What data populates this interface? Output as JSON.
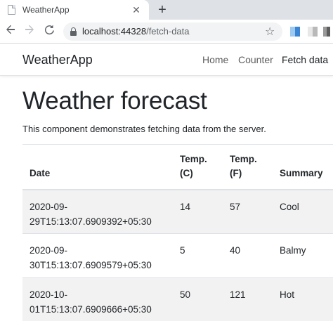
{
  "browser": {
    "tab_title": "WeatherApp",
    "tab_close_glyph": "✕",
    "new_tab_glyph": "+",
    "url_host": "localhost:44328",
    "url_path": "/fetch-data",
    "icons": [
      "favicon-icon",
      "back-arrow-icon",
      "forward-arrow-icon",
      "reload-icon",
      "lock-icon",
      "star-icon",
      "extension-icon"
    ]
  },
  "app": {
    "brand": "WeatherApp",
    "nav": [
      {
        "label": "Home"
      },
      {
        "label": "Counter"
      },
      {
        "label": "Fetch data"
      }
    ]
  },
  "page": {
    "title": "Weather forecast",
    "description": "This component demonstrates fetching data from the server.",
    "table": {
      "headers": [
        "Date",
        "Temp.\n(C)",
        "Temp.\n(F)",
        "Summary"
      ],
      "header_lines": [
        [
          "Date"
        ],
        [
          "Temp.",
          "(C)"
        ],
        [
          "Temp.",
          "(F)"
        ],
        [
          "Summary"
        ]
      ],
      "rows": [
        {
          "date_lines": [
            "2020-09-",
            "29T15:13:07.6909392+05:30"
          ],
          "temp_c": "14",
          "temp_f": "57",
          "summary": "Cool"
        },
        {
          "date_lines": [
            "2020-09-",
            "30T15:13:07.6909579+05:30"
          ],
          "temp_c": "5",
          "temp_f": "40",
          "summary": "Balmy"
        },
        {
          "date_lines": [
            "2020-10-",
            "01T15:13:07.6909666+05:30"
          ],
          "temp_c": "50",
          "temp_f": "121",
          "summary": "Hot"
        }
      ]
    }
  },
  "colors": {
    "tabstrip": "#dee1e6",
    "text": "#212529",
    "stripe": "#f2f2f2",
    "border": "#dee2e6"
  }
}
